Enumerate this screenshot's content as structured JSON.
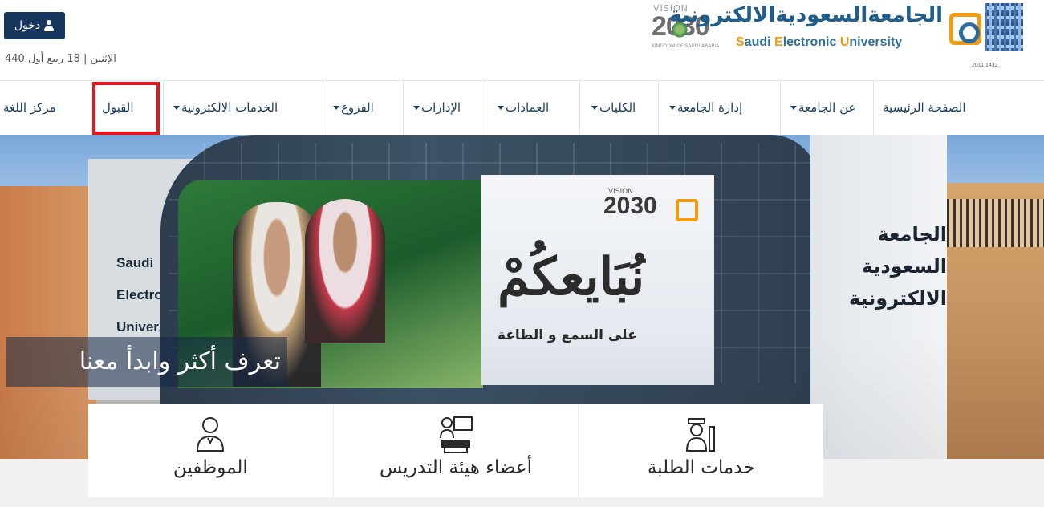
{
  "header": {
    "login_label": "دخول",
    "date": "الإثنين | 18 ربيع أول 440",
    "university_ar": "الجامعةالسعوديةالالكترونية",
    "university_en_1": "S",
    "university_en_2": "audi ",
    "university_en_3": "E",
    "university_en_4": "lectronic ",
    "university_en_5": "U",
    "university_en_6": "niversity",
    "logo_years": "2011          1432",
    "vision_word": "VISION",
    "vision_year": "2030",
    "vision_kingdom": "KINGDOM OF SAUDI ARABIA"
  },
  "nav": {
    "items": [
      {
        "label": "الصفحة الرئيسية",
        "dropdown": false
      },
      {
        "label": "عن الجامعة",
        "dropdown": true
      },
      {
        "label": "إدارة الجامعة",
        "dropdown": true
      },
      {
        "label": "الكليات",
        "dropdown": true
      },
      {
        "label": "العمادات",
        "dropdown": true
      },
      {
        "label": "الإدارات",
        "dropdown": true
      },
      {
        "label": "الفروع",
        "dropdown": true
      },
      {
        "label": "الخدمات الالكترونية",
        "dropdown": true
      },
      {
        "label": "القبول",
        "dropdown": false
      },
      {
        "label": "مركز اللغة",
        "dropdown": false
      }
    ],
    "highlight_color": "#e8141c"
  },
  "hero": {
    "caption": "تعرف أكثر وابدأ معنا",
    "banner_title": "نُبَايعكُمْ",
    "banner_subtitle": "على السمع و الطاعة",
    "banner_vision": "2030",
    "banner_vision_word": "VISION",
    "sign_left": [
      "Saudi",
      "Electron",
      "Universi"
    ],
    "sign_right": [
      "الجامعة",
      "السعودية",
      "الالكترونية"
    ]
  },
  "services": [
    {
      "label": "الموظفين",
      "icon": "employee-icon"
    },
    {
      "label": "أعضاء هيئة التدريس",
      "icon": "faculty-icon"
    },
    {
      "label": "خدمات الطلبة",
      "icon": "student-icon"
    }
  ],
  "colors": {
    "brand_navy": "#16365e",
    "brand_blue": "#1f5d8c",
    "brand_orange": "#f39c12",
    "nav_text": "#1b3f66"
  }
}
